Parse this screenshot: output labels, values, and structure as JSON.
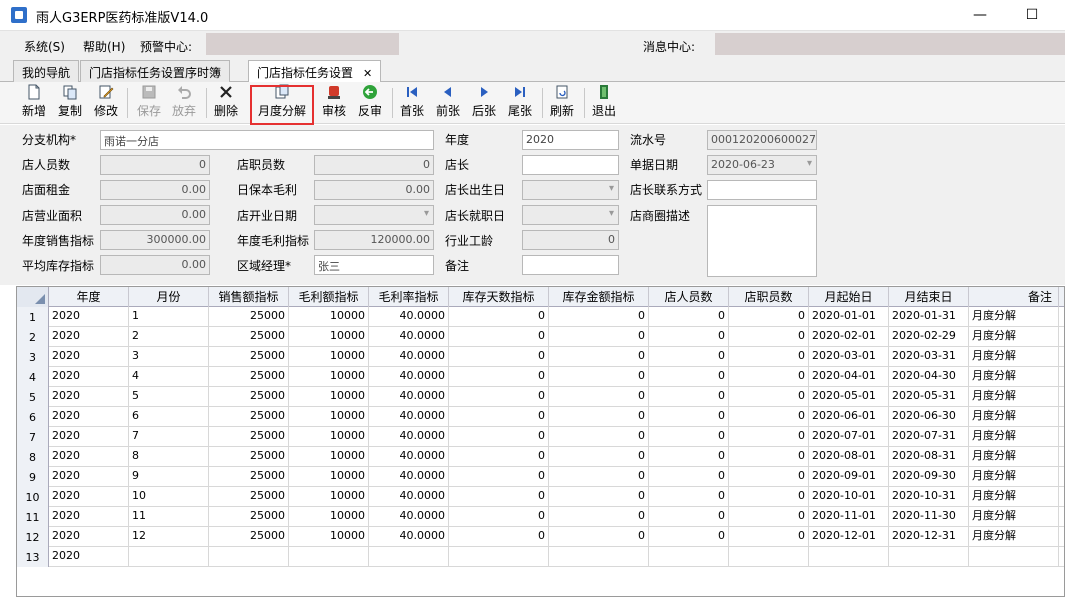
{
  "window": {
    "title": "雨人G3ERP医药标准版V14.0",
    "minimize": "—",
    "maximize": "☐"
  },
  "menu": {
    "system": "系统(S)",
    "help": "帮助(H)",
    "alert_center": "预警中心:",
    "msg_center": "消息中心:"
  },
  "tabs": [
    {
      "label": "我的导航"
    },
    {
      "label": "门店指标任务设置序时簿"
    },
    {
      "label": "门店指标任务设置",
      "close": "✕"
    }
  ],
  "toolbar": {
    "new": "新增",
    "copy": "复制",
    "edit": "修改",
    "save": "保存",
    "discard": "放弃",
    "delete": "删除",
    "monthly_split": "月度分解",
    "approve": "审核",
    "unapprove": "反审",
    "first": "首张",
    "prev": "前张",
    "next": "后张",
    "last": "尾张",
    "refresh": "刷新",
    "exit": "退出"
  },
  "form": {
    "branch_label": "分支机构*",
    "branch_value": "雨诺一分店",
    "year_label": "年度",
    "year_value": "2020",
    "serial_label": "流水号",
    "serial_value": "000120200600027",
    "staff_count_label": "店人员数",
    "staff_count_value": "0",
    "clerk_count_label": "店职员数",
    "clerk_count_value": "0",
    "manager_label": "店长",
    "manager_value": "",
    "doc_date_label": "单据日期",
    "doc_date_value": "2020-06-23",
    "rent_label": "店面租金",
    "rent_value": "0.00",
    "daily_margin_label": "日保本毛利",
    "daily_margin_value": "0.00",
    "manager_birth_label": "店长出生日",
    "manager_birth_value": "",
    "manager_contact_label": "店长联系方式",
    "manager_contact_value": "",
    "area_label": "店营业面积",
    "area_value": "0.00",
    "open_date_label": "店开业日期",
    "open_date_value": "",
    "manager_hire_label": "店长就职日",
    "manager_hire_value": "",
    "business_desc_label": "店商圈描述",
    "business_desc_value": "",
    "annual_sales_label": "年度销售指标",
    "annual_sales_value": "300000.00",
    "annual_margin_label": "年度毛利指标",
    "annual_margin_value": "120000.00",
    "industry_years_label": "行业工龄",
    "industry_years_value": "0",
    "avg_stock_label": "平均库存指标",
    "avg_stock_value": "0.00",
    "region_manager_label": "区域经理*",
    "region_manager_value": "张三",
    "remark_label": "备注",
    "remark_value": ""
  },
  "grid": {
    "columns": [
      "年度",
      "月份",
      "销售额指标",
      "毛利额指标",
      "毛利率指标",
      "库存天数指标",
      "库存金额指标",
      "店人员数",
      "店职员数",
      "月起始日",
      "月结束日",
      "备注"
    ],
    "rows": [
      [
        "1",
        "2020",
        "1",
        "25000",
        "10000",
        "40.0000",
        "0",
        "0",
        "0",
        "0",
        "2020-01-01",
        "2020-01-31",
        "月度分解"
      ],
      [
        "2",
        "2020",
        "2",
        "25000",
        "10000",
        "40.0000",
        "0",
        "0",
        "0",
        "0",
        "2020-02-01",
        "2020-02-29",
        "月度分解"
      ],
      [
        "3",
        "2020",
        "3",
        "25000",
        "10000",
        "40.0000",
        "0",
        "0",
        "0",
        "0",
        "2020-03-01",
        "2020-03-31",
        "月度分解"
      ],
      [
        "4",
        "2020",
        "4",
        "25000",
        "10000",
        "40.0000",
        "0",
        "0",
        "0",
        "0",
        "2020-04-01",
        "2020-04-30",
        "月度分解"
      ],
      [
        "5",
        "2020",
        "5",
        "25000",
        "10000",
        "40.0000",
        "0",
        "0",
        "0",
        "0",
        "2020-05-01",
        "2020-05-31",
        "月度分解"
      ],
      [
        "6",
        "2020",
        "6",
        "25000",
        "10000",
        "40.0000",
        "0",
        "0",
        "0",
        "0",
        "2020-06-01",
        "2020-06-30",
        "月度分解"
      ],
      [
        "7",
        "2020",
        "7",
        "25000",
        "10000",
        "40.0000",
        "0",
        "0",
        "0",
        "0",
        "2020-07-01",
        "2020-07-31",
        "月度分解"
      ],
      [
        "8",
        "2020",
        "8",
        "25000",
        "10000",
        "40.0000",
        "0",
        "0",
        "0",
        "0",
        "2020-08-01",
        "2020-08-31",
        "月度分解"
      ],
      [
        "9",
        "2020",
        "9",
        "25000",
        "10000",
        "40.0000",
        "0",
        "0",
        "0",
        "0",
        "2020-09-01",
        "2020-09-30",
        "月度分解"
      ],
      [
        "10",
        "2020",
        "10",
        "25000",
        "10000",
        "40.0000",
        "0",
        "0",
        "0",
        "0",
        "2020-10-01",
        "2020-10-31",
        "月度分解"
      ],
      [
        "11",
        "2020",
        "11",
        "25000",
        "10000",
        "40.0000",
        "0",
        "0",
        "0",
        "0",
        "2020-11-01",
        "2020-11-30",
        "月度分解"
      ],
      [
        "12",
        "2020",
        "12",
        "25000",
        "10000",
        "40.0000",
        "0",
        "0",
        "0",
        "0",
        "2020-12-01",
        "2020-12-31",
        "月度分解"
      ],
      [
        "13",
        "2020",
        "",
        "",
        "",
        "",
        "",
        "",
        "",
        "",
        "",
        "",
        ""
      ]
    ]
  }
}
